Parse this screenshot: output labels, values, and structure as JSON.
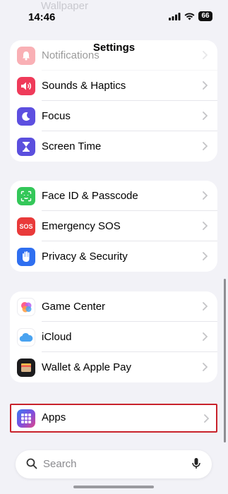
{
  "status_bar": {
    "time": "14:46",
    "battery": "66",
    "ghost_label": "Wallpaper"
  },
  "nav": {
    "title": "Settings"
  },
  "groups": [
    {
      "items": [
        {
          "label": "Notifications",
          "icon": "bell-icon",
          "color": "#ef3b46",
          "faded": true
        },
        {
          "label": "Sounds & Haptics",
          "icon": "speaker-icon",
          "color": "#ef3b5a"
        },
        {
          "label": "Focus",
          "icon": "moon-icon",
          "color": "#5d4fe0"
        },
        {
          "label": "Screen Time",
          "icon": "hourglass-icon",
          "color": "#5b4fde"
        }
      ]
    },
    {
      "items": [
        {
          "label": "Face ID & Passcode",
          "icon": "face-id-icon",
          "color": "#34c759"
        },
        {
          "label": "Emergency SOS",
          "icon": "sos-icon",
          "color": "#e93a3a",
          "icon_text": "SOS"
        },
        {
          "label": "Privacy & Security",
          "icon": "hand-icon",
          "color": "#2f6ff0"
        }
      ]
    },
    {
      "items": [
        {
          "label": "Game Center",
          "icon": "game-center-icon",
          "color": "#ff5e8a"
        },
        {
          "label": "iCloud",
          "icon": "cloud-icon",
          "color": "#4aa3f0"
        },
        {
          "label": "Wallet & Apple Pay",
          "icon": "wallet-icon",
          "color": "#1c1c1e"
        }
      ]
    },
    {
      "items": [
        {
          "label": "Apps",
          "icon": "apps-grid-icon",
          "color": "#6b4fe0",
          "highlighted": true
        }
      ]
    }
  ],
  "search": {
    "placeholder": "Search"
  },
  "colors": {
    "highlight_border": "#c8222b",
    "background": "#f2f2f7"
  }
}
